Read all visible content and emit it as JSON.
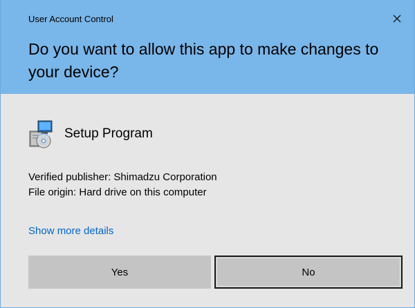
{
  "window": {
    "title": "User Account Control",
    "accent_color": "#79b6e9"
  },
  "prompt": {
    "question": "Do you want to allow this app to make changes to your device?"
  },
  "app": {
    "name": "Setup Program",
    "icon": "setup-program-icon"
  },
  "details": {
    "publisher": "Verified publisher: Shimadzu Corporation",
    "origin": "File origin: Hard drive on this computer"
  },
  "links": {
    "more_details": "Show more details"
  },
  "buttons": {
    "yes": "Yes",
    "no": "No"
  }
}
